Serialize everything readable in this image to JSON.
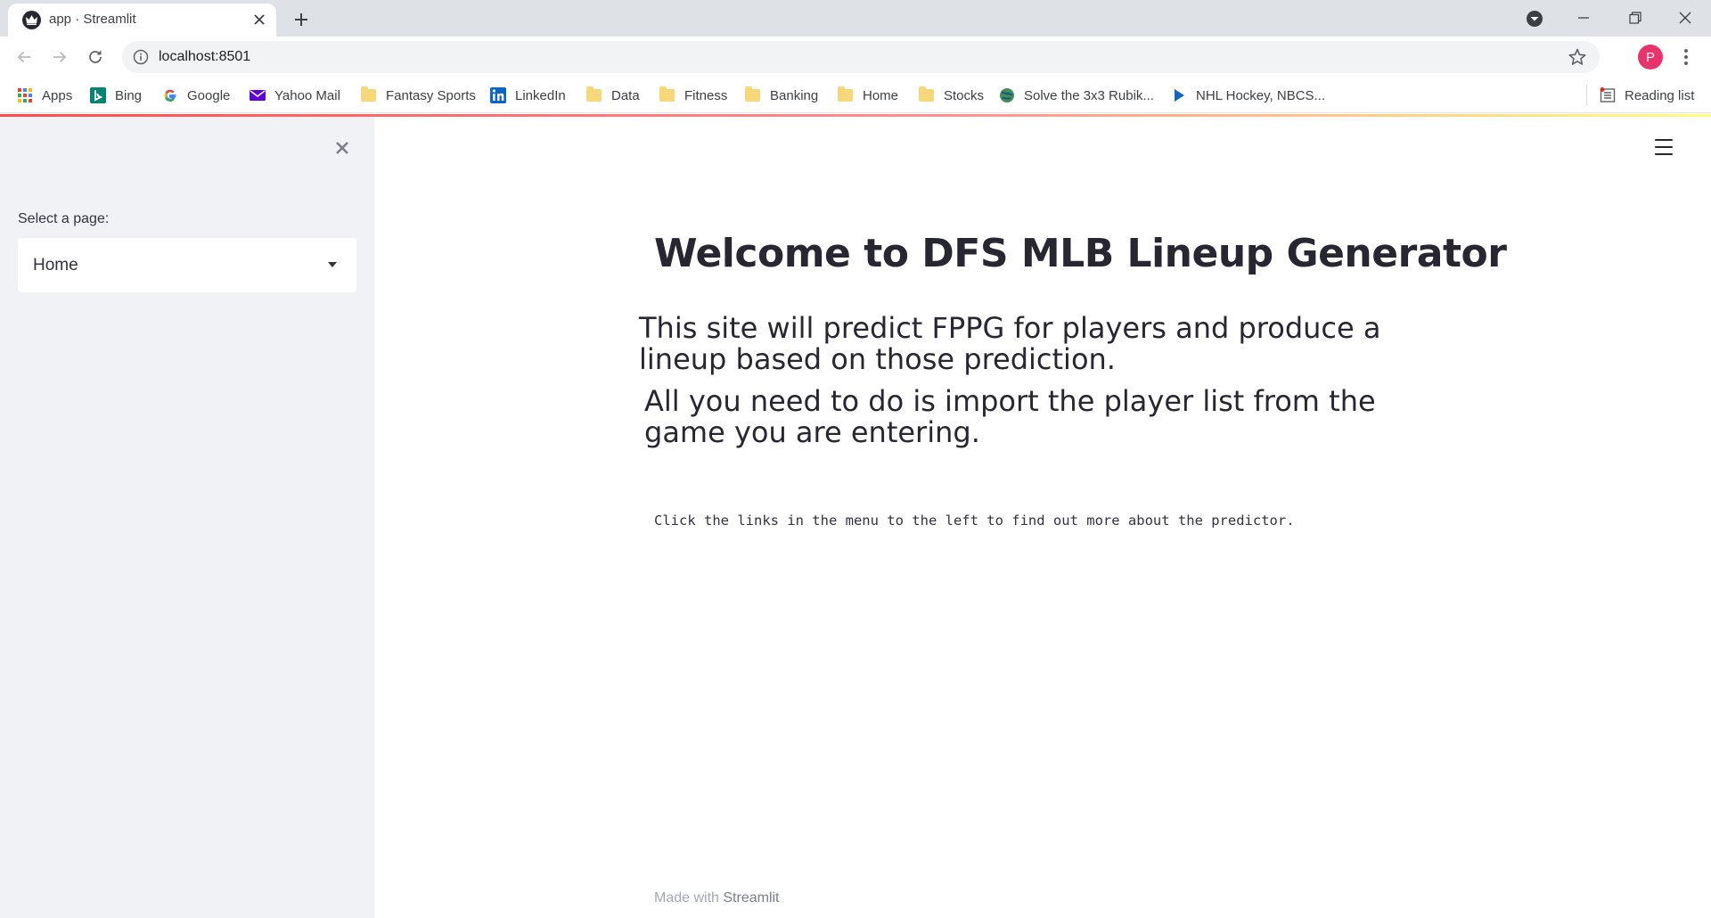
{
  "browser": {
    "tab": {
      "title": "app · Streamlit",
      "favicon": "streamlit-crown-icon"
    },
    "address_bar": {
      "url": "localhost:8501"
    },
    "profile_initial": "P",
    "bookmarks": [
      {
        "label": "Apps",
        "icon": "apps-grid-icon"
      },
      {
        "label": "Bing",
        "icon": "bing-icon"
      },
      {
        "label": "Google",
        "icon": "google-icon"
      },
      {
        "label": "Yahoo Mail",
        "icon": "yahoo-mail-icon"
      },
      {
        "label": "Fantasy Sports",
        "icon": "folder-icon"
      },
      {
        "label": "LinkedIn",
        "icon": "linkedin-icon"
      },
      {
        "label": "Data",
        "icon": "folder-icon"
      },
      {
        "label": "Fitness",
        "icon": "folder-icon"
      },
      {
        "label": "Banking",
        "icon": "folder-icon"
      },
      {
        "label": "Home",
        "icon": "folder-icon"
      },
      {
        "label": "Stocks",
        "icon": "folder-icon"
      },
      {
        "label": "Solve the 3x3 Rubik...",
        "icon": "globe-icon"
      },
      {
        "label": "NHL Hockey, NBCS...",
        "icon": "play-icon"
      }
    ],
    "reading_list": {
      "label": "Reading list",
      "icon": "reading-list-icon"
    }
  },
  "sidebar": {
    "select_label": "Select a page:",
    "selected_page": "Home"
  },
  "main": {
    "title": "Welcome to DFS MLB Lineup Generator",
    "paragraph_1": "This site will predict FPPG for players and produce a lineup based on those prediction.",
    "paragraph_2": "All you need to do is import the player list from the game you are entering.",
    "note": "Click the links in the menu to the left to find out more about the predictor.",
    "footer_prefix": "Made with",
    "footer_brand": "Streamlit"
  },
  "colors": {
    "streamlit_accent": "#ff4b4b",
    "sidebar_bg": "#f0f2f6",
    "text_primary": "#262730",
    "profile_avatar": "#e8336d"
  }
}
